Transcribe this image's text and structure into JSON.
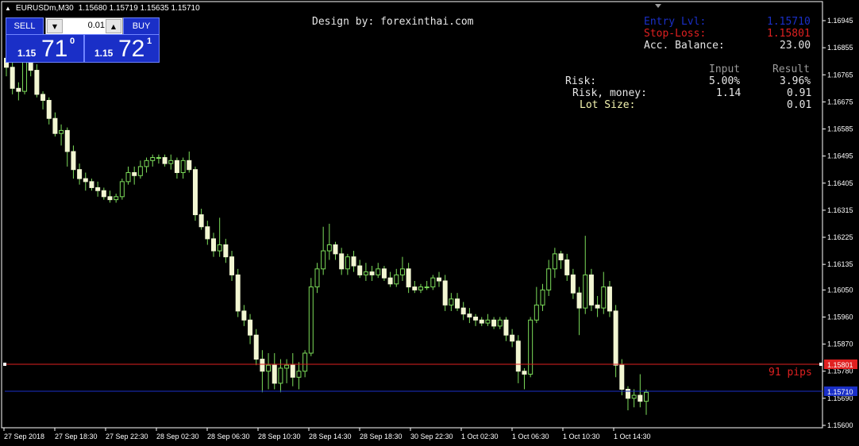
{
  "symbol_bar": {
    "symbol": "EURUSDm,M30",
    "ohlc": "1.15680 1.15719 1.15635 1.15710"
  },
  "one_click": {
    "sell_label": "SELL",
    "buy_label": "BUY",
    "lot_value": "0.01",
    "sell_price": {
      "prefix": "1.15",
      "big": "71",
      "sup": "0"
    },
    "buy_price": {
      "prefix": "1.15",
      "big": "72",
      "sup": "1"
    }
  },
  "design_by": "Design by: forexinthai.com",
  "info_panel": {
    "entry_label": "Entry Lvl:",
    "entry_value": "1.15710",
    "stoploss_label": "Stop-Loss:",
    "stoploss_value": "1.15801",
    "balance_label": "Acc. Balance:",
    "balance_value": "23.00",
    "col_input": "Input",
    "col_result": "Result",
    "risk_label": "Risk:",
    "risk_input": "5.00%",
    "risk_result": "3.96%",
    "risk_money_label": "Risk, money:",
    "risk_money_input": "1.14",
    "risk_money_result": "0.91",
    "lot_label": "Lot Size:",
    "lot_result": "0.01",
    "colors": {
      "entry": "#1a2fc7",
      "stoploss": "#e02020",
      "normal": "#e6e6e6",
      "lot": "#f5f5b0",
      "header": "#9a9a9a"
    }
  },
  "pips_label": "91 pips",
  "price_axis": {
    "ticks": [
      "1.16945",
      "1.16855",
      "1.16765",
      "1.16675",
      "1.16585",
      "1.16495",
      "1.16405",
      "1.16315",
      "1.16225",
      "1.16135",
      "1.16050",
      "1.15960",
      "1.15870",
      "1.15780",
      "1.15690",
      "1.15600"
    ],
    "sl_tag": "1.15801",
    "entry_tag": "1.15710"
  },
  "time_axis": {
    "ticks": [
      "27 Sep 2018",
      "27 Sep 18:30",
      "27 Sep 22:30",
      "28 Sep 02:30",
      "28 Sep 06:30",
      "28 Sep 10:30",
      "28 Sep 14:30",
      "28 Sep 18:30",
      "30 Sep 22:30",
      "1 Oct 02:30",
      "1 Oct 06:30",
      "1 Oct 10:30",
      "1 Oct 14:30"
    ]
  },
  "chart_data": {
    "type": "candlestick",
    "ylim": [
      1.156,
      1.17
    ],
    "ohlc": [
      [
        1.1682,
        1.1684,
        1.1676,
        1.1679
      ],
      [
        1.1679,
        1.1681,
        1.167,
        1.1672
      ],
      [
        1.1672,
        1.1674,
        1.1668,
        1.1671
      ],
      [
        1.1671,
        1.1686,
        1.167,
        1.1684
      ],
      [
        1.1684,
        1.1686,
        1.1676,
        1.1678
      ],
      [
        1.1678,
        1.168,
        1.1669,
        1.167
      ],
      [
        1.167,
        1.1671,
        1.1665,
        1.1668
      ],
      [
        1.1668,
        1.1669,
        1.166,
        1.1662
      ],
      [
        1.1662,
        1.1664,
        1.1656,
        1.1657
      ],
      [
        1.1657,
        1.166,
        1.1653,
        1.1658
      ],
      [
        1.1658,
        1.1659,
        1.1646,
        1.1651
      ],
      [
        1.1651,
        1.1653,
        1.1642,
        1.1645
      ],
      [
        1.1645,
        1.1647,
        1.164,
        1.1642
      ],
      [
        1.1642,
        1.1644,
        1.1638,
        1.1641
      ],
      [
        1.1641,
        1.1642,
        1.1638,
        1.1639
      ],
      [
        1.1639,
        1.1641,
        1.1636,
        1.1638
      ],
      [
        1.1638,
        1.1639,
        1.1635,
        1.1636
      ],
      [
        1.1636,
        1.1638,
        1.1634,
        1.1635
      ],
      [
        1.1635,
        1.1637,
        1.1634,
        1.1636
      ],
      [
        1.1636,
        1.1642,
        1.1635,
        1.1641
      ],
      [
        1.1641,
        1.1646,
        1.164,
        1.1644
      ],
      [
        1.1644,
        1.1646,
        1.164,
        1.1643
      ],
      [
        1.1643,
        1.1648,
        1.1642,
        1.1646
      ],
      [
        1.1646,
        1.1649,
        1.1644,
        1.1648
      ],
      [
        1.1648,
        1.165,
        1.1646,
        1.1649
      ],
      [
        1.1649,
        1.165,
        1.1647,
        1.1649
      ],
      [
        1.1649,
        1.165,
        1.1646,
        1.1647
      ],
      [
        1.1647,
        1.165,
        1.1645,
        1.1648
      ],
      [
        1.1648,
        1.1649,
        1.1642,
        1.1644
      ],
      [
        1.1644,
        1.1649,
        1.1642,
        1.1648
      ],
      [
        1.1648,
        1.1651,
        1.1644,
        1.1645
      ],
      [
        1.1645,
        1.1646,
        1.1628,
        1.163
      ],
      [
        1.163,
        1.1632,
        1.1625,
        1.1626
      ],
      [
        1.1626,
        1.1628,
        1.162,
        1.1622
      ],
      [
        1.1622,
        1.1624,
        1.1616,
        1.1618
      ],
      [
        1.1618,
        1.1629,
        1.1616,
        1.162
      ],
      [
        1.162,
        1.1622,
        1.1614,
        1.1616
      ],
      [
        1.1616,
        1.1618,
        1.1608,
        1.161
      ],
      [
        1.161,
        1.1612,
        1.1596,
        1.1598
      ],
      [
        1.1598,
        1.16,
        1.1593,
        1.1595
      ],
      [
        1.1595,
        1.1597,
        1.1587,
        1.159
      ],
      [
        1.159,
        1.1592,
        1.158,
        1.1582
      ],
      [
        1.1582,
        1.1585,
        1.1571,
        1.1578
      ],
      [
        1.1578,
        1.1584,
        1.1572,
        1.158
      ],
      [
        1.158,
        1.1584,
        1.1572,
        1.1574
      ],
      [
        1.1574,
        1.1582,
        1.1571,
        1.1579
      ],
      [
        1.1579,
        1.1582,
        1.1574,
        1.158
      ],
      [
        1.158,
        1.1584,
        1.1573,
        1.1576
      ],
      [
        1.1576,
        1.1581,
        1.1572,
        1.1578
      ],
      [
        1.1578,
        1.1585,
        1.1576,
        1.1584
      ],
      [
        1.1584,
        1.1609,
        1.1583,
        1.1606
      ],
      [
        1.1606,
        1.1614,
        1.1604,
        1.1612
      ],
      [
        1.1612,
        1.1626,
        1.161,
        1.1618
      ],
      [
        1.1618,
        1.1627,
        1.1615,
        1.162
      ],
      [
        1.162,
        1.1621,
        1.1615,
        1.1617
      ],
      [
        1.1617,
        1.1619,
        1.161,
        1.1612
      ],
      [
        1.1612,
        1.1617,
        1.161,
        1.1616
      ],
      [
        1.1616,
        1.1618,
        1.1611,
        1.1613
      ],
      [
        1.1613,
        1.1615,
        1.1609,
        1.161
      ],
      [
        1.161,
        1.1614,
        1.1608,
        1.1611
      ],
      [
        1.1611,
        1.1613,
        1.1608,
        1.161
      ],
      [
        1.161,
        1.1614,
        1.1609,
        1.1612
      ],
      [
        1.1612,
        1.1613,
        1.1608,
        1.1609
      ],
      [
        1.1609,
        1.1611,
        1.1606,
        1.1607
      ],
      [
        1.1607,
        1.1612,
        1.1606,
        1.161
      ],
      [
        1.161,
        1.1616,
        1.1608,
        1.1612
      ],
      [
        1.1612,
        1.1614,
        1.1604,
        1.1606
      ],
      [
        1.1606,
        1.1608,
        1.1604,
        1.1605
      ],
      [
        1.1605,
        1.1607,
        1.1604,
        1.1606
      ],
      [
        1.1606,
        1.1608,
        1.1605,
        1.1606
      ],
      [
        1.1606,
        1.161,
        1.1605,
        1.1609
      ],
      [
        1.1609,
        1.1611,
        1.1606,
        1.1608
      ],
      [
        1.1608,
        1.161,
        1.1598,
        1.16
      ],
      [
        1.16,
        1.1604,
        1.1598,
        1.1602
      ],
      [
        1.1602,
        1.1604,
        1.1598,
        1.1599
      ],
      [
        1.1599,
        1.1601,
        1.1595,
        1.1597
      ],
      [
        1.1597,
        1.1599,
        1.1594,
        1.1596
      ],
      [
        1.1596,
        1.1597,
        1.1593,
        1.1595
      ],
      [
        1.1595,
        1.1596,
        1.1593,
        1.1594
      ],
      [
        1.1594,
        1.1597,
        1.1593,
        1.1595
      ],
      [
        1.1595,
        1.1596,
        1.1592,
        1.1593
      ],
      [
        1.1593,
        1.1596,
        1.1592,
        1.1595
      ],
      [
        1.1595,
        1.1596,
        1.1588,
        1.159
      ],
      [
        1.159,
        1.1592,
        1.1586,
        1.1588
      ],
      [
        1.1588,
        1.159,
        1.1574,
        1.1578
      ],
      [
        1.1578,
        1.1579,
        1.1572,
        1.1577
      ],
      [
        1.1577,
        1.1596,
        1.1576,
        1.1595
      ],
      [
        1.1595,
        1.1606,
        1.1594,
        1.16
      ],
      [
        1.16,
        1.1607,
        1.1598,
        1.1605
      ],
      [
        1.1605,
        1.1615,
        1.1603,
        1.1612
      ],
      [
        1.1612,
        1.1619,
        1.1609,
        1.1617
      ],
      [
        1.1617,
        1.1618,
        1.1612,
        1.1615
      ],
      [
        1.1615,
        1.1617,
        1.1608,
        1.161
      ],
      [
        1.161,
        1.1612,
        1.1602,
        1.1604
      ],
      [
        1.1604,
        1.1606,
        1.159,
        1.1599
      ],
      [
        1.1599,
        1.1623,
        1.1597,
        1.161
      ],
      [
        1.161,
        1.1612,
        1.1598,
        1.16
      ],
      [
        1.16,
        1.1603,
        1.1596,
        1.1599
      ],
      [
        1.1599,
        1.1611,
        1.1597,
        1.1606
      ],
      [
        1.1606,
        1.1608,
        1.1596,
        1.1598
      ],
      [
        1.1598,
        1.16,
        1.1576,
        1.158
      ],
      [
        1.158,
        1.1582,
        1.157,
        1.1572
      ],
      [
        1.1572,
        1.1573,
        1.1565,
        1.1569
      ],
      [
        1.1569,
        1.1572,
        1.1566,
        1.157
      ],
      [
        1.157,
        1.1577,
        1.1566,
        1.1568
      ],
      [
        1.1568,
        1.15719,
        1.15635,
        1.1571
      ]
    ]
  }
}
